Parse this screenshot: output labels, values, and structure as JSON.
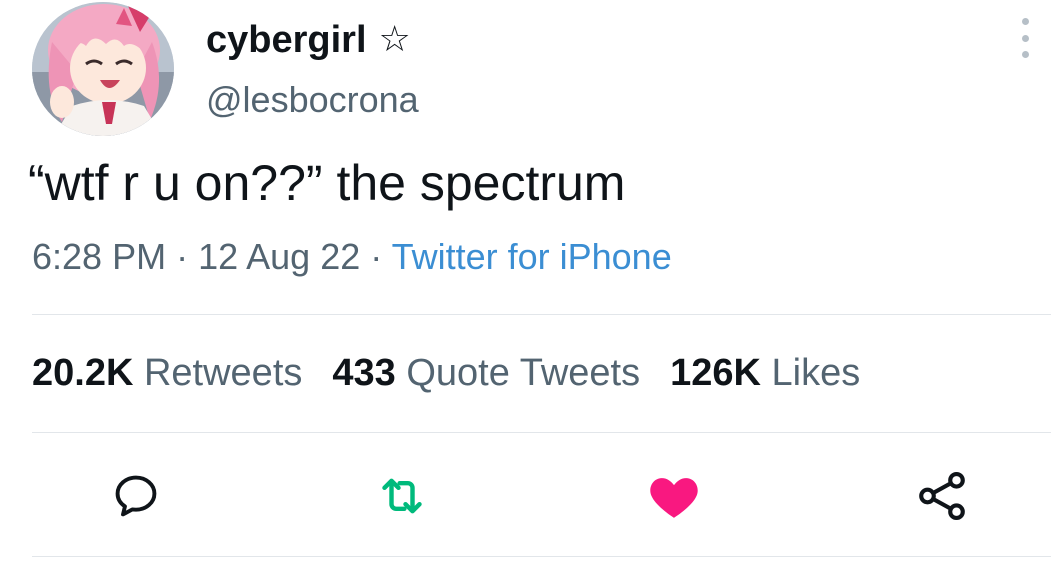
{
  "user": {
    "display_name": "cybergirl",
    "name_glyph": "☆",
    "handle": "@lesbocrona",
    "avatar_icon": "anime-girl-avatar"
  },
  "tweet": {
    "text": "“wtf r u on??” the spectrum",
    "time": "6:28 PM",
    "separator": " · ",
    "date": "12 Aug 22",
    "source": "Twitter for iPhone"
  },
  "stats": {
    "retweets_count": "20.2K",
    "retweets_label": "Retweets",
    "quotes_count": "433",
    "quotes_label": "Quote Tweets",
    "likes_count": "126K",
    "likes_label": "Likes"
  },
  "actions": {
    "reply_icon": "reply-icon",
    "retweet_icon": "retweet-icon",
    "like_icon": "heart-icon",
    "share_icon": "share-icon"
  },
  "colors": {
    "text": "#0f1419",
    "secondary": "#536471",
    "link": "#3b8ed3",
    "retweet": "#00ba7c",
    "like": "#f91880"
  }
}
